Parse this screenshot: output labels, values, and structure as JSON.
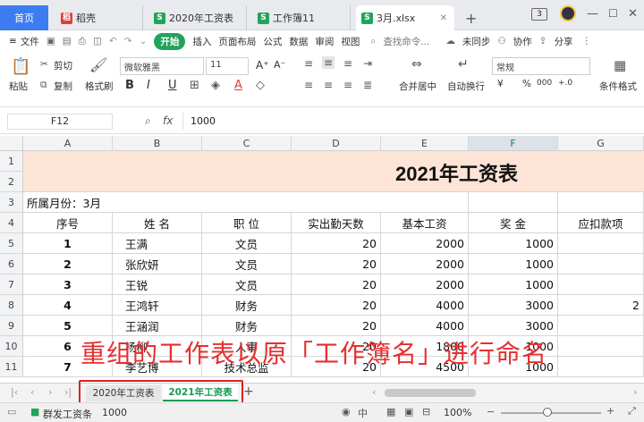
{
  "tabs": {
    "home": "首页",
    "daoke": "稻壳",
    "file1": "2020年工资表",
    "file2": "工作簿11",
    "file3": "3月.xlsx",
    "new_tab": "+",
    "badge": "3"
  },
  "menu": {
    "file": "文件",
    "start": "开始",
    "insert": "插入",
    "layout": "页面布局",
    "formula": "公式",
    "data": "数据",
    "review": "审阅",
    "view": "视图",
    "search": "查找命令...",
    "sync": "未同步",
    "collab": "协作",
    "share": "分享"
  },
  "ribbon": {
    "paste": "粘贴",
    "cut": "剪切",
    "copy": "复制",
    "format_painter": "格式刷",
    "font": "微软雅黑",
    "size": "11",
    "merge": "合并居中",
    "wrap": "自动换行",
    "numformat": "常规",
    "cond_format": "条件格式",
    "currency": "¥",
    "percent": "%",
    "thousand": "000",
    "bold": "B",
    "italic": "I",
    "underline": "U",
    "font_color": "A",
    "inc_dec": "+.0"
  },
  "formula": {
    "cellref": "F12",
    "fx": "fx",
    "value": "1000"
  },
  "columns": [
    "A",
    "B",
    "C",
    "D",
    "E",
    "F",
    "G"
  ],
  "rows": [
    "1",
    "2",
    "3",
    "4",
    "5",
    "6",
    "7",
    "8",
    "9",
    "10",
    "11"
  ],
  "sheet_title": "2021年工资表",
  "month_label": "所属月份：3月",
  "headers": [
    "序号",
    "姓  名",
    "职  位",
    "实出勤天数",
    "基本工资",
    "奖  金",
    "应扣款项"
  ],
  "data_rows": [
    [
      "1",
      "王满",
      "文员",
      "20",
      "2000",
      "1000",
      ""
    ],
    [
      "2",
      "张欣妍",
      "文员",
      "20",
      "2000",
      "1000",
      ""
    ],
    [
      "3",
      "王锐",
      "文员",
      "20",
      "2000",
      "1000",
      ""
    ],
    [
      "4",
      "王鸿轩",
      "财务",
      "20",
      "4000",
      "3000",
      "2"
    ],
    [
      "5",
      "王涵润",
      "财务",
      "20",
      "4000",
      "3000",
      ""
    ],
    [
      "6",
      "杨柳",
      "人事",
      "20",
      "1800",
      "1000",
      ""
    ],
    [
      "7",
      "李艺博",
      "技术总监",
      "20",
      "4500",
      "1000",
      ""
    ]
  ],
  "sheets": {
    "sheet1": "2020年工资表",
    "sheet2": "2021年工资表",
    "add": "+"
  },
  "status": {
    "macro": "群发工资条",
    "value": "1000",
    "zoom": "100%"
  },
  "overlay_text": "重组的工作表以原「工作簿名」进行命名",
  "colors": {
    "accent_green": "#22a35a",
    "title_fill": "#fde4d6",
    "home_blue": "#3c7cf0",
    "overlay_red": "#e62e2e"
  }
}
